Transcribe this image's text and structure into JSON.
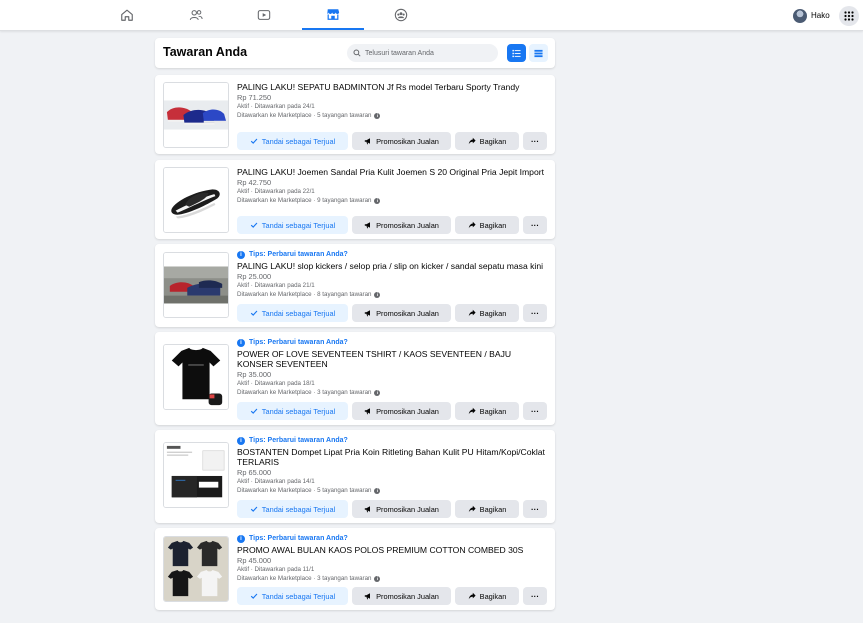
{
  "nav": {
    "tabs": [
      {
        "name": "home-icon"
      },
      {
        "name": "friends-icon"
      },
      {
        "name": "watch-icon"
      },
      {
        "name": "marketplace-icon"
      },
      {
        "name": "groups-icon"
      }
    ],
    "active_tab": 3,
    "user_name": "Hako",
    "menu_icon": "grid-menu-icon",
    "accent_color": "#1877f2"
  },
  "header": {
    "title": "Tawaran Anda",
    "search_placeholder": "Telusuri tawaran Anda"
  },
  "buttons": {
    "mark_sold": "Tandai sebagai Terjual",
    "promote": "Promosikan Jualan",
    "share": "Bagikan",
    "more": "···"
  },
  "tips_text": "Tips: Perbarui tawaran Anda?",
  "listings": [
    {
      "tips": false,
      "title": "PALING LAKU! SEPATU BADMINTON Jf Rs model Terbaru Sporty Trandy",
      "price": "Rp 71.250",
      "status": "Aktif · Ditawarkan pada 24/1",
      "views": "Ditawarkan ke Marketplace · 5 tayangan tawaran",
      "image": "shoes"
    },
    {
      "tips": false,
      "title": "PALING LAKU! Joemen Sandal Pria Kulit Joemen S 20 Original Pria Jepit Import",
      "price": "Rp 42.750",
      "status": "Aktif · Ditawarkan pada 22/1",
      "views": "Ditawarkan ke Marketplace · 9 tayangan tawaran",
      "image": "sandal"
    },
    {
      "tips": true,
      "title": "PALING LAKU! slop kickers / selop pria / slip on kicker / sandal sepatu masa kini",
      "price": "Rp 25.000",
      "status": "Aktif · Ditawarkan pada 21/1",
      "views": "Ditawarkan ke Marketplace · 8 tayangan tawaran",
      "image": "slipon"
    },
    {
      "tips": true,
      "title": "POWER OF LOVE SEVENTEEN TSHIRT / KAOS SEVENTEEN / BAJU KONSER SEVENTEEN",
      "price": "Rp 35.000",
      "status": "Aktif · Ditawarkan pada 18/1",
      "views": "Ditawarkan ke Marketplace · 3 tayangan tawaran",
      "image": "tshirt"
    },
    {
      "tips": true,
      "title": "BOSTANTEN Dompet Lipat Pria Koin Ritleting Bahan Kulit PU Hitam/Kopi/Coklat TERLARIS",
      "price": "Rp 65.000",
      "status": "Aktif · Ditawarkan pada 14/1",
      "views": "Ditawarkan ke Marketplace · 5 tayangan tawaran",
      "image": "wallet"
    },
    {
      "tips": true,
      "title": "PROMO AWAL BULAN KAOS POLOS PREMIUM COTTON COMBED 30S",
      "price": "Rp 45.000",
      "status": "Aktif · Ditawarkan pada 11/1",
      "views": "Ditawarkan ke Marketplace · 3 tayangan tawaran",
      "image": "plain-tshirts"
    }
  ]
}
